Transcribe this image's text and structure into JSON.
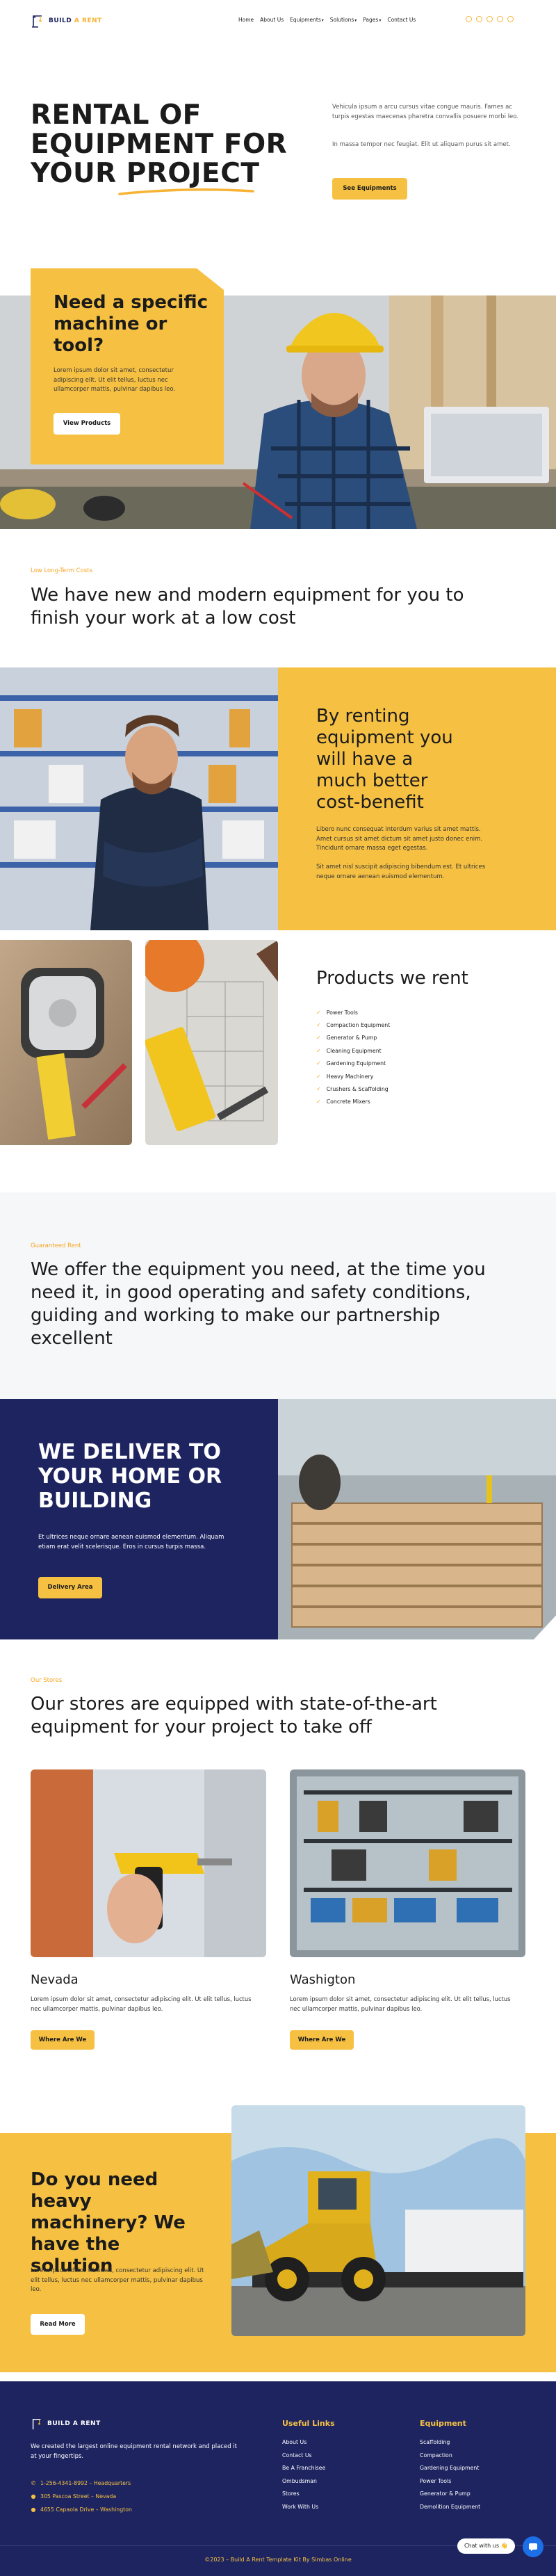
{
  "header": {
    "brand": "BUILD A RENT",
    "brand_part1": "BUILD",
    "brand_part2": "A RENT",
    "nav": [
      {
        "label": "Home",
        "dropdown": false
      },
      {
        "label": "About Us",
        "dropdown": false
      },
      {
        "label": "Equipments",
        "dropdown": true
      },
      {
        "label": "Solutions",
        "dropdown": true
      },
      {
        "label": "Pages",
        "dropdown": true
      },
      {
        "label": "Contact Us",
        "dropdown": false
      }
    ],
    "social_icons": [
      "facebook-icon",
      "twitter-icon",
      "instagram-icon",
      "youtube-icon",
      "linkedin-icon"
    ]
  },
  "hero": {
    "title_line1": "RENTAL OF",
    "title_line2": "EQUIPMENT FOR",
    "title_line3a": "YOUR ",
    "title_line3b": "PROJECT",
    "desc1": "Vehicula ipsum a arcu cursus vitae congue mauris. Fames ac turpis egestas maecenas pharetra convallis posuere morbi leo.",
    "desc2": "In massa tempor nec feugiat. Elit ut aliquam purus sit amet.",
    "button": "See Equipments"
  },
  "specific": {
    "title": "Need a specific machine or tool?",
    "text": "Lorem ipsum dolor sit amet, consectetur adipiscing elit. Ut elit tellus, luctus nec ullamcorper mattis, pulvinar dapibus leo.",
    "button": "View Products"
  },
  "longterm": {
    "eyebrow": "Low Long-Term Costs",
    "title": "We have new and modern equipment for you to finish your work at a low cost"
  },
  "benefit": {
    "title": "By renting equipment you will have a much better cost-benefit",
    "text1": "Libero nunc consequat interdum varius sit amet mattis. Amet cursus sit amet dictum sit amet justo donec enim. Tincidunt ornare massa eget egestas.",
    "text2": "Sit amet nisl suscipit adipiscing bibendum est. Et ultrices neque ornare aenean euismod elementum."
  },
  "products": {
    "title": "Products we rent",
    "items": [
      "Power Tools",
      "Compaction Equipment",
      "Generator & Pump",
      "Cleaning Equipment",
      "Gardening Equipment",
      "Heavy Machinery",
      "Crushers & Scaffolding",
      "Concrete Mixers"
    ]
  },
  "guaranteed": {
    "eyebrow": "Guaranteed Rent",
    "title": "We offer the equipment you need, at the time you need it, in good operating and safety conditions, guiding and working to make our partnership excellent"
  },
  "deliver": {
    "title": "WE DELIVER TO YOUR HOME OR BUILDING",
    "text": "Et ultrices neque ornare aenean euismod elementum. Aliquam etiam erat velit scelerisque. Eros in cursus turpis massa.",
    "button": "Delivery Area"
  },
  "stores": {
    "eyebrow": "Our Stores",
    "title": "Our stores are equipped with state-of-the-art equipment for your project to take off",
    "list": [
      {
        "name": "Nevada",
        "text": "Lorem ipsum dolor sit amet, consectetur adipiscing elit. Ut elit tellus, luctus nec ullamcorper mattis, pulvinar dapibus leo.",
        "button": "Where Are We"
      },
      {
        "name": "Washigton",
        "text": "Lorem ipsum dolor sit amet, consectetur adipiscing elit. Ut elit tellus, luctus nec ullamcorper mattis, pulvinar dapibus leo.",
        "button": "Where Are We"
      }
    ]
  },
  "heavy": {
    "title": "Do you need heavy machinery? We have the solution",
    "text": "Lorem ipsum dolor sit amet, consectetur adipiscing elit. Ut elit tellus, luctus nec ullamcorper mattis, pulvinar dapibus leo.",
    "button": "Read More"
  },
  "footer": {
    "brand": "BUILD A RENT",
    "tagline": "We created the largest online equipment rental network and placed it at your fingertips.",
    "contacts": [
      {
        "icon": "phone-icon",
        "text": "1-256-4341-8992 – Headquarters"
      },
      {
        "icon": "pin-icon",
        "text": "305 Pascoa Street – Nevada"
      },
      {
        "icon": "pin-icon",
        "text": "4655 Capaola Drive – Washington"
      }
    ],
    "links_title": "Useful Links",
    "links": [
      "About Us",
      "Contact Us",
      "Be A Franchisee",
      "Ombudsman",
      "Stores",
      "Work With Us"
    ],
    "equipment_title": "Equipment",
    "equipment": [
      "Scaffolding",
      "Compaction",
      "Gardening Equipment",
      "Power Tools",
      "Generator & Pump",
      "Demolition Equipment"
    ],
    "copyright": "©2023 – Build A Rent Template Kit By Simbas Online",
    "chat_label": "Chat with us 👋"
  },
  "colors": {
    "accent": "#f6c143",
    "navy": "#1d2460",
    "eyebrow": "#f6a623",
    "light_bg": "#f6f7f8"
  }
}
